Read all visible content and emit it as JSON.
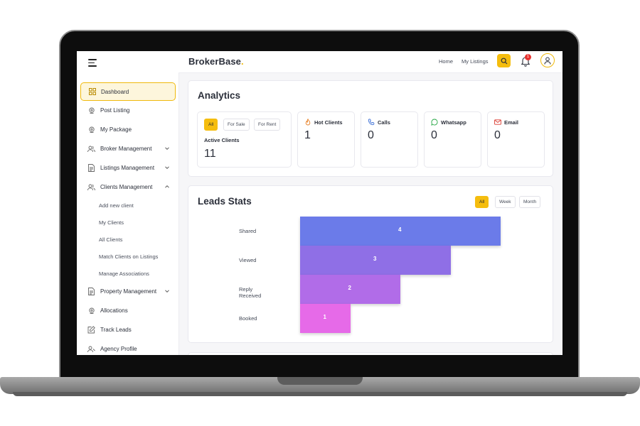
{
  "brand": {
    "name": "BrokerBase",
    "dot": "."
  },
  "topnav": {
    "home": "Home",
    "my_listings": "My Listings",
    "notification_count": "1"
  },
  "sidebar": {
    "items": [
      {
        "label": "Dashboard"
      },
      {
        "label": "Post Listing"
      },
      {
        "label": "My Package"
      },
      {
        "label": "Broker Management"
      },
      {
        "label": "Listings Management"
      },
      {
        "label": "Clients Management"
      },
      {
        "label": "Property Management"
      },
      {
        "label": "Allocations"
      },
      {
        "label": "Track Leads"
      },
      {
        "label": "Agency Profile"
      }
    ],
    "sub_items": [
      {
        "label": "Add new client"
      },
      {
        "label": "My Clients"
      },
      {
        "label": "All Clients"
      },
      {
        "label": "Match Clients on Listings"
      },
      {
        "label": "Manage Associations"
      }
    ]
  },
  "analytics": {
    "title": "Analytics",
    "filters": [
      "All",
      "For Sale",
      "For Rent"
    ],
    "active_filter": "All",
    "active_clients": {
      "label": "Active Clients",
      "value": "11"
    },
    "stats": [
      {
        "label": "Hot Clients",
        "value": "1",
        "icon": "flame-icon"
      },
      {
        "label": "Calls",
        "value": "0",
        "icon": "phone-icon"
      },
      {
        "label": "Whatsapp",
        "value": "0",
        "icon": "whatsapp-icon"
      },
      {
        "label": "Email",
        "value": "0",
        "icon": "mail-icon"
      }
    ]
  },
  "leads": {
    "title": "Leads Stats",
    "ranges": [
      "All",
      "Week",
      "Month"
    ],
    "active_range": "All"
  },
  "chart_data": {
    "type": "bar",
    "orientation": "horizontal",
    "categories": [
      "Shared",
      "Viewed",
      "Reply Received",
      "Booked"
    ],
    "values": [
      4,
      3,
      2,
      1
    ],
    "colors": [
      "#6b7be9",
      "#8f6fe6",
      "#b16ce8",
      "#e66ae8"
    ]
  },
  "colors": {
    "accent": "#f5bd0e",
    "notification": "#e8332f"
  }
}
